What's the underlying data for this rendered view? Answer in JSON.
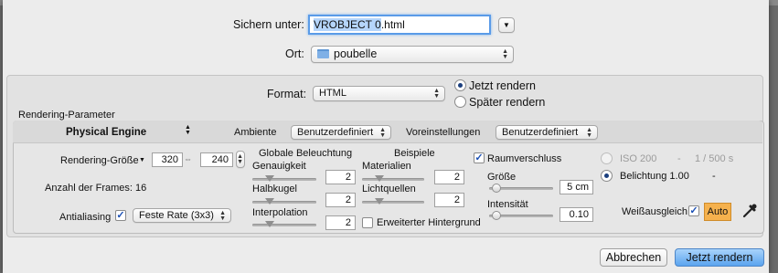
{
  "save_as": {
    "label": "Sichern unter:",
    "value_selected": "VROBJECT 0",
    "value_rest": ".html"
  },
  "location": {
    "label": "Ort:",
    "folder": "poubelle"
  },
  "format": {
    "label": "Format:",
    "value": "HTML"
  },
  "render_options": {
    "now": "Jetzt rendern",
    "later": "Später rendern",
    "selected": "now"
  },
  "rendering_params": {
    "title": "Rendering-Parameter"
  },
  "engine": {
    "name": "Physical Engine",
    "ambiente_label": "Ambiente",
    "ambiente_value": "Benutzerdefiniert",
    "presets_label": "Voreinstellungen",
    "presets_value": "Benutzerdefiniert"
  },
  "size": {
    "label": "Rendering-Größe",
    "width": "320",
    "height": "240"
  },
  "frames": {
    "label": "Anzahl der Frames: 16"
  },
  "antialiasing": {
    "label": "Antialiasing",
    "checked": true,
    "value": "Feste Rate (3x3)"
  },
  "global_illumination": {
    "title": "Globale Beleuchtung",
    "accuracy_label": "Genauigkeit",
    "accuracy_value": "2",
    "hemisphere_label": "Halbkugel",
    "hemisphere_value": "2",
    "interpolation_label": "Interpolation",
    "interpolation_value": "2"
  },
  "examples": {
    "title": "Beispiele",
    "materials_label": "Materialien",
    "materials_value": "2",
    "lights_label": "Lichtquellen",
    "lights_value": "2",
    "extended_bg_label": "Erweiterter Hintergrund",
    "extended_bg_checked": false
  },
  "occlusion": {
    "label": "Raumverschluss",
    "checked": true,
    "size_label": "Größe",
    "size_value": "5 cm",
    "intensity_label": "Intensität",
    "intensity_value": "0.10"
  },
  "camera": {
    "iso_label": "ISO 200",
    "shutter_label": "1 / 500 s",
    "exposure_label": "Belichtung 1.00",
    "exposure_selected": true
  },
  "white_balance": {
    "label": "Weißausgleich",
    "checked": true,
    "auto_label": "Auto"
  },
  "buttons": {
    "cancel": "Abbrechen",
    "render_now": "Jetzt rendern"
  },
  "colors": {
    "default_button": "#5ba4ef",
    "auto_badge": "#f5b14d",
    "focus_ring": "#5a9be8"
  }
}
